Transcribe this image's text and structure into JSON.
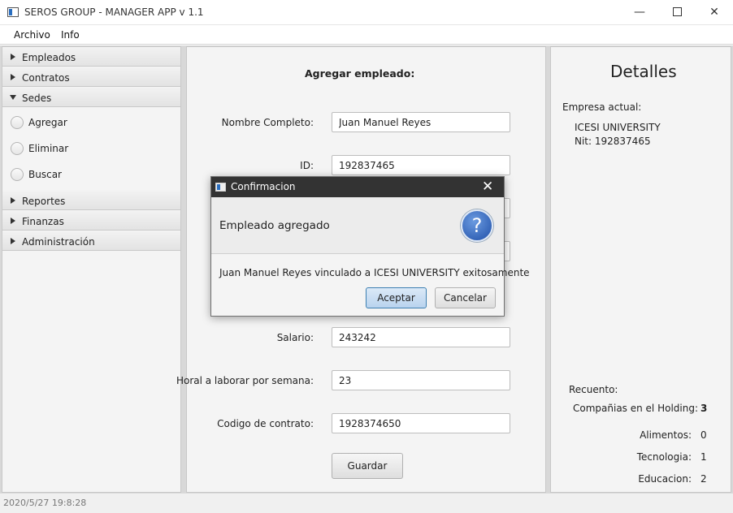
{
  "window": {
    "title": "SEROS GROUP - MANAGER APP  v 1.1",
    "minimize": "—",
    "close": "✕"
  },
  "menubar": [
    "Archivo",
    "Info"
  ],
  "sidebar": {
    "sections": [
      {
        "label": "Empleados",
        "expanded": false
      },
      {
        "label": "Contratos",
        "expanded": false
      },
      {
        "label": "Sedes",
        "expanded": true,
        "options": [
          "Agregar",
          "Eliminar",
          "Buscar"
        ]
      },
      {
        "label": "Reportes",
        "expanded": false
      },
      {
        "label": "Finanzas",
        "expanded": false
      },
      {
        "label": "Administración",
        "expanded": false
      }
    ]
  },
  "form": {
    "title": "Agregar empleado:",
    "fields": [
      {
        "label": "Nombre Completo:",
        "value": "Juan Manuel Reyes"
      },
      {
        "label": "ID:",
        "value": "192837465"
      },
      {
        "label": "",
        "value": ""
      },
      {
        "label": "",
        "value": ""
      },
      {
        "label": "Salario:",
        "value": "243242"
      },
      {
        "label": "Horal a laborar por semana:",
        "value": "23"
      },
      {
        "label": "Codigo de contrato:",
        "value": "1928374650"
      }
    ],
    "save_label": "Guardar"
  },
  "details": {
    "title": "Detalles",
    "company_label": "Empresa actual:",
    "company_name": "ICESI UNIVERSITY",
    "company_nit": "Nit: 192837465",
    "count_label": "Recuento:",
    "counts": [
      {
        "label": "Compañias en el Holding:",
        "value": "3"
      },
      {
        "label": "Alimentos:",
        "value": "0"
      },
      {
        "label": "Tecnologia:",
        "value": "1"
      },
      {
        "label": "Educacion:",
        "value": "2"
      }
    ]
  },
  "status": {
    "datetime": "2020/5/27   19:8:28"
  },
  "dialog": {
    "title": "Confirmacion",
    "header": "Empleado agregado",
    "icon": "question-icon",
    "icon_glyph": "?",
    "content": "Juan Manuel Reyes vinculado a ICESI UNIVERSITY exitosamente",
    "ok_label": "Aceptar",
    "cancel_label": "Cancelar",
    "close": "✕"
  }
}
